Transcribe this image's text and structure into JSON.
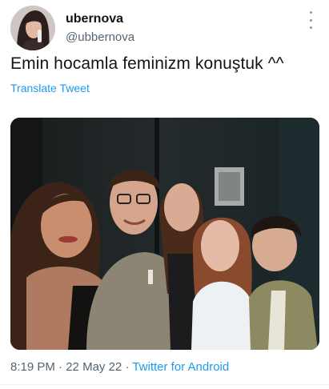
{
  "user": {
    "display_name": "ubernova",
    "handle": "@ubbernova"
  },
  "tweet": {
    "text": "Emin hocamla feminizm konuştuk ^^",
    "translate_label": "Translate Tweet",
    "time": "8:19 PM",
    "date": "22 May 22",
    "separator": "·",
    "source": "Twitter for Android"
  },
  "icons": {
    "more": "more-vertical-icon"
  },
  "colors": {
    "link": "#1d9bf0",
    "secondary_text": "#536471",
    "primary_text": "#0f1419"
  }
}
